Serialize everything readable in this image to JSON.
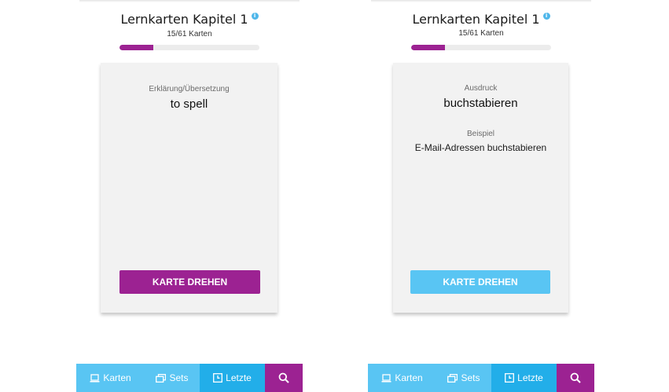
{
  "colors": {
    "primary_purple": "#9c2292",
    "primary_blue": "#59c5f3",
    "active_tab": "#22aee9",
    "card_bg": "#f2f2f2",
    "info_icon": "#4fb7ea"
  },
  "panels": [
    {
      "title": "Lernkarten Kapitel 1",
      "info_icon": "info-icon",
      "count": "15/61 Karten",
      "progress": 0.24,
      "side": "back",
      "fields": [
        {
          "label": "Erklärung/Übersetzung",
          "value": "to spell"
        }
      ],
      "flip_button": {
        "label": "KARTE DREHEN",
        "color": "#9c2292"
      }
    },
    {
      "title": "Lernkarten Kapitel 1",
      "info_icon": "info-icon",
      "count": "15/61 Karten",
      "progress": 0.24,
      "side": "front",
      "fields": [
        {
          "label": "Ausdruck",
          "value": "buchstabieren"
        },
        {
          "label": "Beispiel",
          "value": "E-Mail-Adressen buchstabieren"
        }
      ],
      "flip_button": {
        "label": "KARTE DREHEN",
        "color": "#59c5f3"
      }
    }
  ],
  "nav": {
    "items": [
      {
        "label": "Karten",
        "icon": "laptop-icon"
      },
      {
        "label": "Sets",
        "icon": "stacked-cards-icon"
      },
      {
        "label": "Letzte",
        "icon": "clock-icon",
        "active": true
      },
      {
        "label": "",
        "icon": "search-icon"
      }
    ]
  }
}
